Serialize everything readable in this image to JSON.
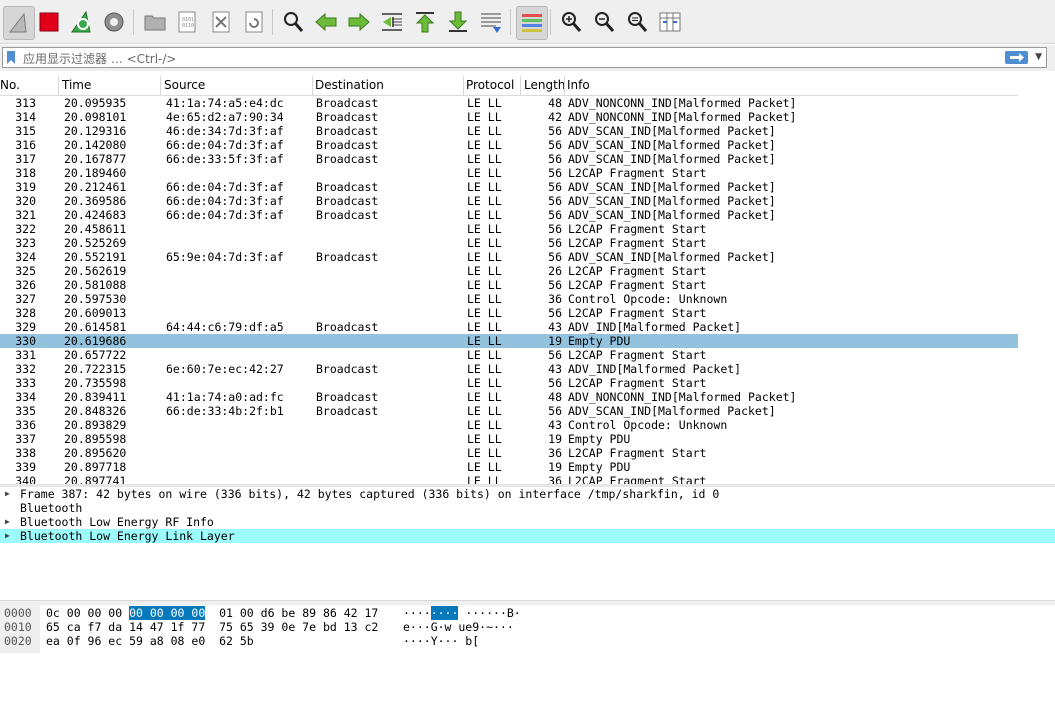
{
  "toolbar": {
    "buttons": [
      {
        "icon": "shark-fin-start-icon"
      },
      {
        "icon": "stop-icon"
      },
      {
        "icon": "restart-capture-icon"
      },
      {
        "icon": "capture-options-icon"
      },
      {
        "icon": "open-file-icon"
      },
      {
        "icon": "save-file-icon"
      },
      {
        "icon": "close-file-icon"
      },
      {
        "icon": "reload-file-icon"
      },
      {
        "icon": "find-packet-icon"
      },
      {
        "icon": "go-back-icon"
      },
      {
        "icon": "go-forward-icon"
      },
      {
        "icon": "go-to-packet-icon"
      },
      {
        "icon": "go-first-icon"
      },
      {
        "icon": "go-last-icon"
      },
      {
        "icon": "autoscroll-icon"
      },
      {
        "icon": "colorize-icon"
      },
      {
        "icon": "zoom-in-icon"
      },
      {
        "icon": "zoom-out-icon"
      },
      {
        "icon": "zoom-reset-icon"
      },
      {
        "icon": "resize-columns-icon"
      }
    ]
  },
  "filter": {
    "placeholder": "应用显示过滤器 … <Ctrl-/>"
  },
  "columns": {
    "no": "No.",
    "time": "Time",
    "source": "Source",
    "destination": "Destination",
    "protocol": "Protocol",
    "length": "Length",
    "info": "Info"
  },
  "packets": [
    {
      "no": "313",
      "time": "20.095935",
      "source": "41:1a:74:a5:e4:dc",
      "destination": "Broadcast",
      "protocol": "LE LL",
      "length": "48",
      "info": "ADV_NONCONN_IND[Malformed Packet]"
    },
    {
      "no": "314",
      "time": "20.098101",
      "source": "4e:65:d2:a7:90:34",
      "destination": "Broadcast",
      "protocol": "LE LL",
      "length": "42",
      "info": "ADV_NONCONN_IND[Malformed Packet]"
    },
    {
      "no": "315",
      "time": "20.129316",
      "source": "46:de:34:7d:3f:af",
      "destination": "Broadcast",
      "protocol": "LE LL",
      "length": "56",
      "info": "ADV_SCAN_IND[Malformed Packet]"
    },
    {
      "no": "316",
      "time": "20.142080",
      "source": "66:de:04:7d:3f:af",
      "destination": "Broadcast",
      "protocol": "LE LL",
      "length": "56",
      "info": "ADV_SCAN_IND[Malformed Packet]"
    },
    {
      "no": "317",
      "time": "20.167877",
      "source": "66:de:33:5f:3f:af",
      "destination": "Broadcast",
      "protocol": "LE LL",
      "length": "56",
      "info": "ADV_SCAN_IND[Malformed Packet]"
    },
    {
      "no": "318",
      "time": "20.189460",
      "source": "",
      "destination": "",
      "protocol": "LE LL",
      "length": "56",
      "info": "L2CAP Fragment Start"
    },
    {
      "no": "319",
      "time": "20.212461",
      "source": "66:de:04:7d:3f:af",
      "destination": "Broadcast",
      "protocol": "LE LL",
      "length": "56",
      "info": "ADV_SCAN_IND[Malformed Packet]"
    },
    {
      "no": "320",
      "time": "20.369586",
      "source": "66:de:04:7d:3f:af",
      "destination": "Broadcast",
      "protocol": "LE LL",
      "length": "56",
      "info": "ADV_SCAN_IND[Malformed Packet]"
    },
    {
      "no": "321",
      "time": "20.424683",
      "source": "66:de:04:7d:3f:af",
      "destination": "Broadcast",
      "protocol": "LE LL",
      "length": "56",
      "info": "ADV_SCAN_IND[Malformed Packet]"
    },
    {
      "no": "322",
      "time": "20.458611",
      "source": "",
      "destination": "",
      "protocol": "LE LL",
      "length": "56",
      "info": "L2CAP Fragment Start"
    },
    {
      "no": "323",
      "time": "20.525269",
      "source": "",
      "destination": "",
      "protocol": "LE LL",
      "length": "56",
      "info": "L2CAP Fragment Start"
    },
    {
      "no": "324",
      "time": "20.552191",
      "source": "65:9e:04:7d:3f:af",
      "destination": "Broadcast",
      "protocol": "LE LL",
      "length": "56",
      "info": "ADV_SCAN_IND[Malformed Packet]"
    },
    {
      "no": "325",
      "time": "20.562619",
      "source": "",
      "destination": "",
      "protocol": "LE LL",
      "length": "26",
      "info": "L2CAP Fragment Start"
    },
    {
      "no": "326",
      "time": "20.581088",
      "source": "",
      "destination": "",
      "protocol": "LE LL",
      "length": "56",
      "info": "L2CAP Fragment Start"
    },
    {
      "no": "327",
      "time": "20.597530",
      "source": "",
      "destination": "",
      "protocol": "LE LL",
      "length": "36",
      "info": "Control Opcode: Unknown"
    },
    {
      "no": "328",
      "time": "20.609013",
      "source": "",
      "destination": "",
      "protocol": "LE LL",
      "length": "56",
      "info": "L2CAP Fragment Start"
    },
    {
      "no": "329",
      "time": "20.614581",
      "source": "64:44:c6:79:df:a5",
      "destination": "Broadcast",
      "protocol": "LE LL",
      "length": "43",
      "info": "ADV_IND[Malformed Packet]"
    },
    {
      "no": "330",
      "time": "20.619686",
      "source": "",
      "destination": "",
      "protocol": "LE LL",
      "length": "19",
      "info": "Empty PDU",
      "selected": true
    },
    {
      "no": "331",
      "time": "20.657722",
      "source": "",
      "destination": "",
      "protocol": "LE LL",
      "length": "56",
      "info": "L2CAP Fragment Start"
    },
    {
      "no": "332",
      "time": "20.722315",
      "source": "6e:60:7e:ec:42:27",
      "destination": "Broadcast",
      "protocol": "LE LL",
      "length": "43",
      "info": "ADV_IND[Malformed Packet]"
    },
    {
      "no": "333",
      "time": "20.735598",
      "source": "",
      "destination": "",
      "protocol": "LE LL",
      "length": "56",
      "info": "L2CAP Fragment Start"
    },
    {
      "no": "334",
      "time": "20.839411",
      "source": "41:1a:74:a0:ad:fc",
      "destination": "Broadcast",
      "protocol": "LE LL",
      "length": "48",
      "info": "ADV_NONCONN_IND[Malformed Packet]"
    },
    {
      "no": "335",
      "time": "20.848326",
      "source": "66:de:33:4b:2f:b1",
      "destination": "Broadcast",
      "protocol": "LE LL",
      "length": "56",
      "info": "ADV_SCAN_IND[Malformed Packet]"
    },
    {
      "no": "336",
      "time": "20.893829",
      "source": "",
      "destination": "",
      "protocol": "LE LL",
      "length": "43",
      "info": "Control Opcode: Unknown"
    },
    {
      "no": "337",
      "time": "20.895598",
      "source": "",
      "destination": "",
      "protocol": "LE LL",
      "length": "19",
      "info": "Empty PDU"
    },
    {
      "no": "338",
      "time": "20.895620",
      "source": "",
      "destination": "",
      "protocol": "LE LL",
      "length": "36",
      "info": "L2CAP Fragment Start"
    },
    {
      "no": "339",
      "time": "20.897718",
      "source": "",
      "destination": "",
      "protocol": "LE LL",
      "length": "19",
      "info": "Empty PDU"
    },
    {
      "no": "340",
      "time": "20.897741",
      "source": "",
      "destination": "",
      "protocol": "LE LL",
      "length": "36",
      "info": "L2CAP Fragment Start"
    }
  ],
  "details": [
    {
      "text": "Frame 387: 42 bytes on wire (336 bits), 42 bytes captured (336 bits) on interface /tmp/sharkfin, id 0",
      "expandable": true
    },
    {
      "text": "Bluetooth",
      "expandable": false
    },
    {
      "text": "Bluetooth Low Energy RF Info",
      "expandable": true
    },
    {
      "text": "Bluetooth Low Energy Link Layer",
      "expandable": true,
      "selected": true
    }
  ],
  "bytes": [
    {
      "offset": "0000",
      "hex_pre": "0c 00 00 00 ",
      "hex_hl": "00 00 00 00",
      "hex_post": "  01 00 d6 be 89 86 42 17",
      "ascii_pre": "····",
      "ascii_hl": "····",
      "ascii_post": " ······B·"
    },
    {
      "offset": "0010",
      "hex_pre": "65 ca f7 da 14 47 1f 77  75 65 39 0e 7e bd 13 c2",
      "hex_hl": "",
      "hex_post": "",
      "ascii_pre": "e···G·w ue9·~···",
      "ascii_hl": "",
      "ascii_post": ""
    },
    {
      "offset": "0020",
      "hex_pre": "ea 0f 96 ec 59 a8 08 e0  62 5b",
      "hex_hl": "",
      "hex_post": "",
      "ascii_pre": "····Y··· b[",
      "ascii_hl": "",
      "ascii_post": ""
    }
  ],
  "colors": {
    "selected_row": "#92c2dd",
    "selected_detail": "#9cfcfc",
    "byte_highlight": "#0679bd"
  }
}
